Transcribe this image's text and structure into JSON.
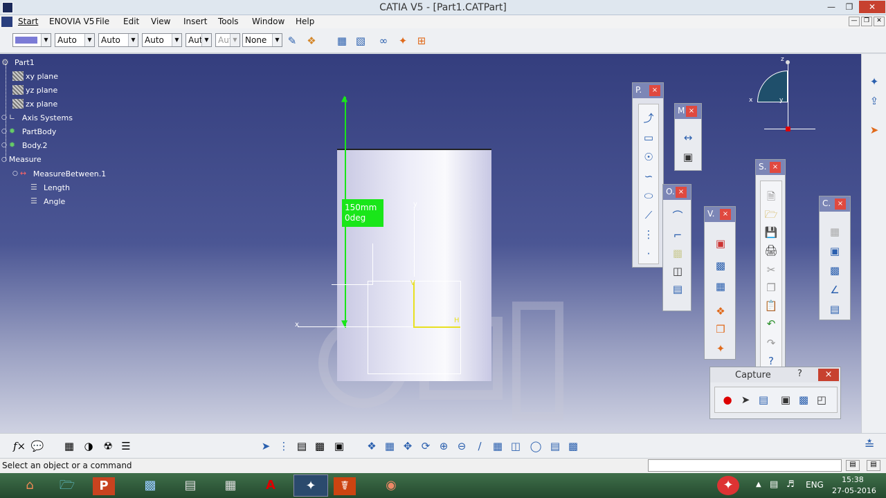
{
  "window": {
    "title": "CATIA V5 - [Part1.CATPart]"
  },
  "menu": {
    "items": [
      "Start",
      "ENOVIA V5",
      "File",
      "Edit",
      "View",
      "Insert",
      "Tools",
      "Window",
      "Help"
    ]
  },
  "toolbar": {
    "combos": [
      "Auto",
      "Auto",
      "Auto",
      "Aut",
      "Aut",
      "None"
    ]
  },
  "tree": {
    "items": [
      "Part1",
      "xy plane",
      "yz plane",
      "zx plane",
      "Axis Systems",
      "PartBody",
      "Body.2",
      "Measure",
      "MeasureBetween.1",
      "Length",
      "Angle"
    ]
  },
  "measure": {
    "length": "150mm",
    "angle": "0deg"
  },
  "compass": {
    "x": "x",
    "y": "y",
    "z": "z"
  },
  "axis": {
    "x": "x",
    "y": "y",
    "h": "H",
    "v": "V"
  },
  "panels": {
    "p": "P.",
    "m": "M",
    "o": "O.",
    "v": "V.",
    "s": "S.",
    "c": "C.",
    "capture": "Capture",
    "capture_help": "?",
    "close": "×"
  },
  "status": {
    "text": "Select an object or a command"
  },
  "taskbar": {
    "lang": "ENG",
    "time": "15:38",
    "date": "27-05-2016"
  },
  "colors": {
    "accent": "#19e619",
    "close": "#e0493f"
  }
}
